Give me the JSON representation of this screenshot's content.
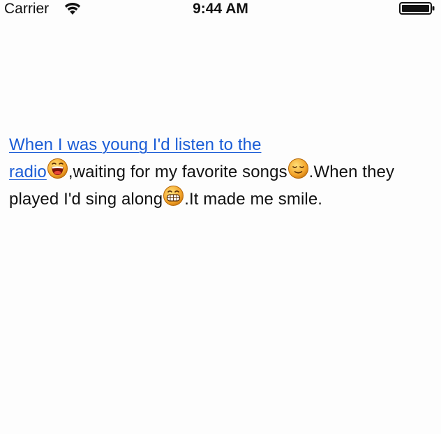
{
  "status_bar": {
    "carrier": "Carrier",
    "time": "9:44 AM",
    "wifi_icon": "wifi-icon",
    "battery_icon": "battery-icon"
  },
  "message": {
    "link_text_line1": "When I was young I'd listen to the",
    "link_text_line2": "radio",
    "segment_1": ",waiting for my favorite songs",
    "segment_2": ".When they played I'd sing along",
    "segment_3": ".It made me smile.",
    "emoticons": [
      "laughing-face-emoticon",
      "content-smile-emoticon",
      "grinning-face-emoticon"
    ]
  }
}
